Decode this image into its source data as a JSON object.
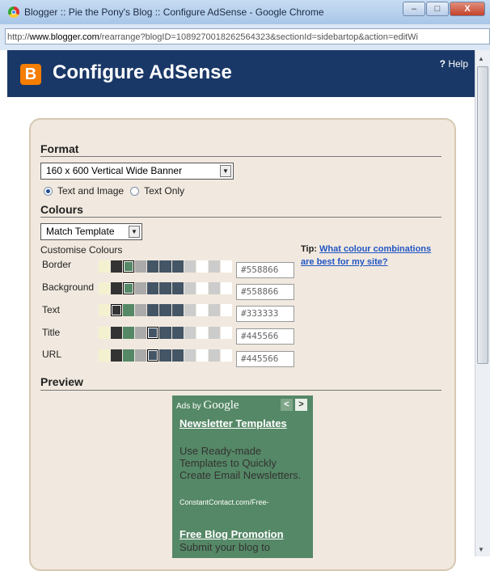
{
  "window": {
    "title": "Blogger :: Pie the Pony's Blog :: Configure AdSense - Google Chrome",
    "minimize": "–",
    "maximize": "□",
    "close": "X"
  },
  "address": {
    "prefix": "http://",
    "domain": "www.blogger.com",
    "path": "/rearrange?blogID=1089270018262564323&sectionId=sidebartop&action=editWi"
  },
  "header": {
    "logo_letter": "B",
    "title": "Configure AdSense",
    "help_q": "?",
    "help_label": "Help"
  },
  "format": {
    "heading": "Format",
    "selected": "160 x 600 Vertical Wide Banner",
    "radio_text_image": "Text and Image",
    "radio_text_only": "Text Only"
  },
  "colours": {
    "heading": "Colours",
    "selected": "Match Template",
    "customise_label": "Customise Colours",
    "swatch_palette": [
      "#f4f1d0",
      "#333333",
      "#558866",
      "#aaaaaa",
      "#445566",
      "#445566",
      "#445566",
      "#cccccc",
      "#ffffff",
      "#cccccc",
      "#ffffff"
    ],
    "rows": [
      {
        "label": "Border",
        "value": "#558866",
        "selected": 2
      },
      {
        "label": "Background",
        "value": "#558866",
        "selected": 2
      },
      {
        "label": "Text",
        "value": "#333333",
        "selected": 1
      },
      {
        "label": "Title",
        "value": "#445566",
        "selected": 4
      },
      {
        "label": "URL",
        "value": "#445566",
        "selected": 4
      }
    ],
    "tip_label": "Tip:",
    "tip_link": "What colour combinations are best for my site?"
  },
  "preview": {
    "heading": "Preview",
    "ads_by": "Ads by",
    "google": "Google",
    "prev_icon": "<",
    "next_icon": ">",
    "ad1_title": "Newsletter Templates",
    "ad1_text": "Use Ready-made Templates to Quickly Create Email Newsletters.",
    "ad1_url": "ConstantContact.com/Free-",
    "ad2_title": "Free Blog Promotion",
    "ad2_text": "Submit your blog to"
  }
}
